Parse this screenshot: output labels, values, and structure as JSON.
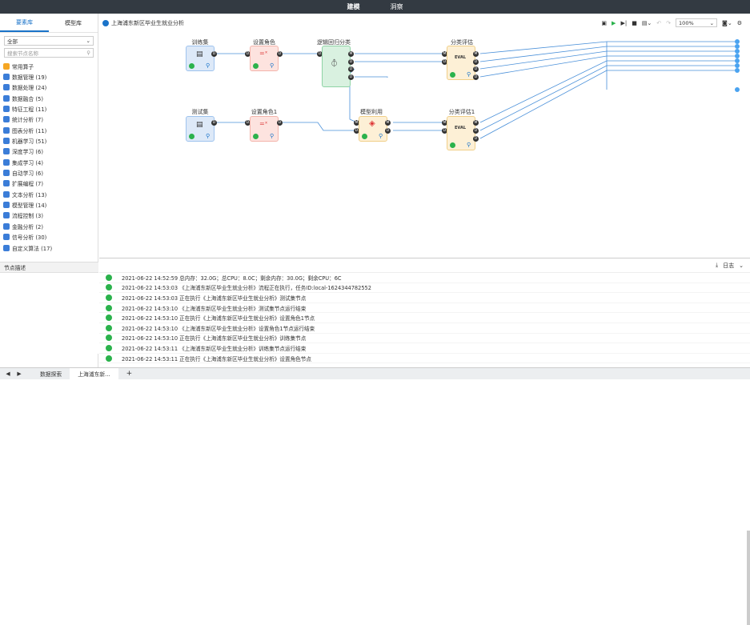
{
  "topbar": {
    "tabs": [
      "建模",
      "洞察"
    ]
  },
  "left": {
    "tabs": [
      "要素库",
      "模型库"
    ],
    "filter": "全部",
    "search_placeholder": "搜索节点名称",
    "categories": [
      {
        "label": "常用算子",
        "icon": "star-icon",
        "color": "#f5a623"
      },
      {
        "label": "数据管理 (19)",
        "icon": "database-icon",
        "color": "#3b7dd8"
      },
      {
        "label": "数据处理 (24)",
        "icon": "process-icon",
        "color": "#3b7dd8"
      },
      {
        "label": "数据融合 (5)",
        "icon": "merge-icon",
        "color": "#3b7dd8"
      },
      {
        "label": "特征工程 (11)",
        "icon": "feature-icon",
        "color": "#3b7dd8"
      },
      {
        "label": "统计分析 (7)",
        "icon": "stats-icon",
        "color": "#3b7dd8"
      },
      {
        "label": "图表分析 (11)",
        "icon": "chart-icon",
        "color": "#3b7dd8"
      },
      {
        "label": "机器学习 (51)",
        "icon": "ml-icon",
        "color": "#3b7dd8"
      },
      {
        "label": "深度学习 (6)",
        "icon": "deep-learning-icon",
        "color": "#3b7dd8"
      },
      {
        "label": "集成学习 (4)",
        "icon": "ensemble-icon",
        "color": "#3b7dd8"
      },
      {
        "label": "自动学习 (6)",
        "icon": "auto-learning-icon",
        "color": "#3b7dd8"
      },
      {
        "label": "扩展编程 (7)",
        "icon": "code-icon",
        "color": "#3b7dd8"
      },
      {
        "label": "文本分析 (13)",
        "icon": "text-icon",
        "color": "#3b7dd8"
      },
      {
        "label": "模型管理 (14)",
        "icon": "model-icon",
        "color": "#3b7dd8"
      },
      {
        "label": "流程控制 (3)",
        "icon": "flow-icon",
        "color": "#3b7dd8"
      },
      {
        "label": "金融分析 (2)",
        "icon": "finance-icon",
        "color": "#3b7dd8"
      },
      {
        "label": "信号分析 (30)",
        "icon": "signal-icon",
        "color": "#3b7dd8"
      },
      {
        "label": "自定义算法 (17)",
        "icon": "custom-icon",
        "color": "#3b7dd8"
      }
    ],
    "node_desc_title": "节点描述"
  },
  "canvas": {
    "title": "上海浦东新区毕业生就业分析",
    "zoom": "100%",
    "nodes": [
      {
        "label": "训练集"
      },
      {
        "label": "设置角色"
      },
      {
        "label": "逻辑回归分类"
      },
      {
        "label": "分类评估"
      },
      {
        "label": "测试集"
      },
      {
        "label": "设置角色1"
      },
      {
        "label": "模型利用"
      },
      {
        "label": "分类评估1"
      }
    ],
    "port_letters": {
      "d": "D",
      "m": "M"
    },
    "eval_text": "EVAL"
  },
  "log": {
    "label": "日志",
    "lines": [
      "2021-06-22 14:52:59 总内存：32.0G；总CPU：8.0C；剩余内存：30.0G；剩余CPU：6C",
      "2021-06-22 14:53:03 《上海浦东新区毕业生就业分析》流程正在执行，任务ID:local-1624344782552",
      "2021-06-22 14:53:03 正在执行《上海浦东新区毕业生就业分析》测试集节点",
      "2021-06-22 14:53:10 《上海浦东新区毕业生就业分析》测试集节点运行结束",
      "2021-06-22 14:53:10 正在执行《上海浦东新区毕业生就业分析》设置角色1节点",
      "2021-06-22 14:53:10 《上海浦东新区毕业生就业分析》设置角色1节点运行结束",
      "2021-06-22 14:53:10 正在执行《上海浦东新区毕业生就业分析》训练集节点",
      "2021-06-22 14:53:11 《上海浦东新区毕业生就业分析》训练集节点运行结束",
      "2021-06-22 14:53:11 正在执行《上海浦东新区毕业生就业分析》设置角色节点"
    ]
  },
  "bottom": {
    "tabs": [
      "数据探索",
      "上海浦东新..."
    ],
    "add": "+"
  }
}
